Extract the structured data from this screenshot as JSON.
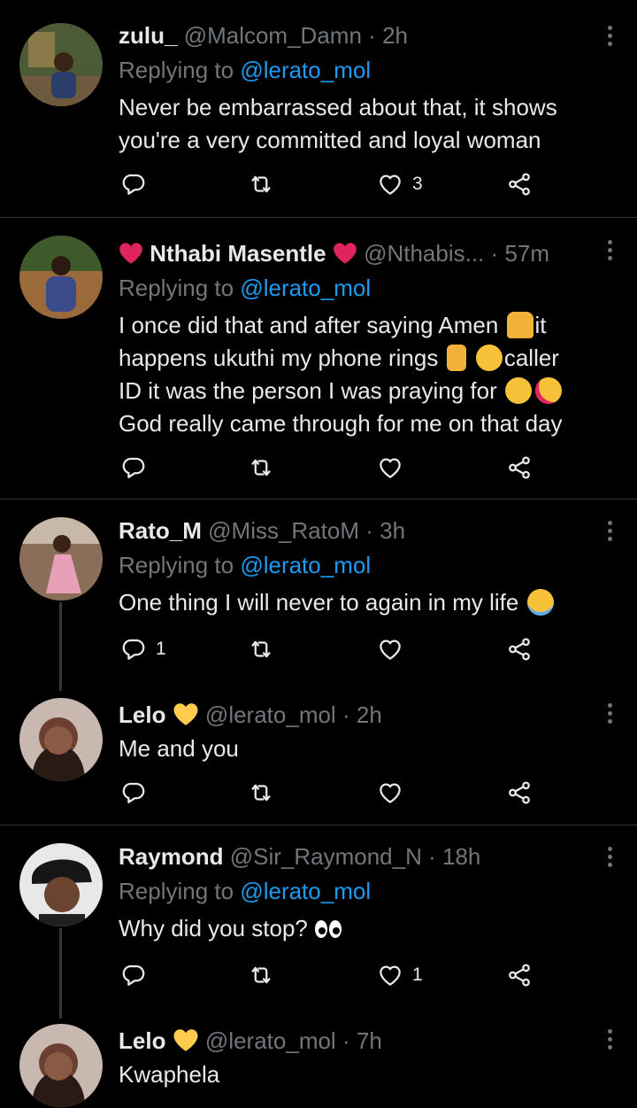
{
  "tweets": [
    {
      "name": "zulu_",
      "handle": "@Malcom_Damn",
      "time": "2h",
      "replying_label": "Replying to",
      "replying_to": "@lerato_mol",
      "text_lines": [
        "Never be embarrassed about that, it shows",
        "you're a very committed and loyal woman"
      ],
      "replies": "",
      "retweets": "",
      "likes": "3",
      "avatar_color": "#5a6b3c"
    },
    {
      "name": "Nthabi Masentle",
      "handle": "@Nthabis...",
      "time": "57m",
      "replying_label": "Replying to",
      "replying_to": "@lerato_mol",
      "text_lines": [
        "I once did that and after saying Amen",
        "it",
        "happens ukuthi my phone rings",
        "caller",
        "ID it was the person I was praying for",
        "God really came through for me on that day"
      ],
      "likes": "",
      "avatar_color": "#7a5a3a"
    },
    {
      "name": "Rato_M",
      "handle": "@Miss_RatoM",
      "time": "3h",
      "replying_label": "Replying to",
      "replying_to": "@lerato_mol",
      "text": "One thing I will never to again in my life",
      "replies": "1",
      "avatar_color": "#c7a088"
    },
    {
      "name": "Lelo",
      "handle": "@lerato_mol",
      "time": "2h",
      "text": "Me and you",
      "avatar_color": "#6b4a3a"
    },
    {
      "name": "Raymond",
      "handle": "@Sir_Raymond_N",
      "time": "18h",
      "replying_label": "Replying to",
      "replying_to": "@lerato_mol",
      "text": "Why did you stop?",
      "likes": "1",
      "avatar_color": "#d8d8d8"
    },
    {
      "name": "Lelo",
      "handle": "@lerato_mol",
      "time": "7h",
      "text": "Kwaphela",
      "avatar_color": "#6b4a3a"
    }
  ],
  "separator": "·",
  "colors": {
    "background": "#000000",
    "text": "#e7e9ea",
    "muted": "#71767b",
    "link": "#1d9bf0",
    "heart_red": "#e0245e",
    "heart_yellow": "#ffcc4d"
  },
  "icons": [
    "reply-icon",
    "retweet-icon",
    "like-icon",
    "share-icon",
    "more-icon"
  ]
}
